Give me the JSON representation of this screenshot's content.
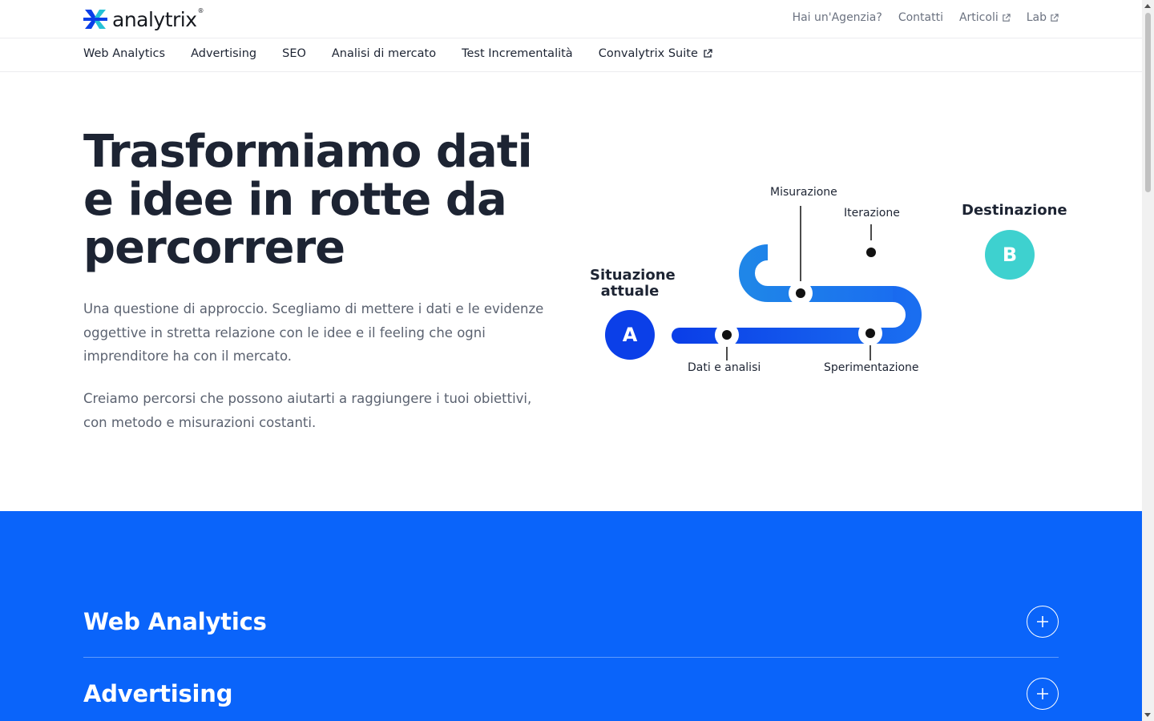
{
  "brand": {
    "name": "analytrix",
    "mark": "®"
  },
  "top_links": [
    {
      "label": "Hai un'Agenzia?",
      "external": false
    },
    {
      "label": "Contatti",
      "external": false
    },
    {
      "label": "Articoli",
      "external": true
    },
    {
      "label": "Lab",
      "external": true
    }
  ],
  "main_nav": [
    {
      "label": "Web Analytics"
    },
    {
      "label": "Advertising"
    },
    {
      "label": "SEO"
    },
    {
      "label": "Analisi di mercato"
    },
    {
      "label": "Test Incrementalità"
    },
    {
      "label": "Convalytrix Suite"
    }
  ],
  "hero": {
    "title": "Trasformiamo dati e idee in rotte da percorrere",
    "paragraph_1": "Una questione di approccio. Scegliamo di mettere i dati e le evidenze oggettive in stretta relazione con le idee e il feeling che ogni imprenditore ha con il mercato.",
    "paragraph_2": "Creiamo percorsi che possono aiutarti a raggiungere i tuoi obiettivi, con metodo e misurazioni costanti."
  },
  "diagram": {
    "start_label_line1": "Situazione",
    "start_label_line2": "attuale",
    "start_letter": "A",
    "end_label": "Destinazione",
    "end_letter": "B",
    "steps": {
      "data": "Dati e  analisi",
      "experiment": "Sperimentazione",
      "measure": "Misurazione",
      "iterate": "Iterazione"
    }
  },
  "sections": [
    {
      "title": "Web Analytics"
    },
    {
      "title": "Advertising"
    }
  ],
  "colors": {
    "accent_blue": "#0a64fa",
    "start_blue": "#0b3fe8",
    "end_teal": "#3ed1cf",
    "text_dark": "#1d2433",
    "text_muted": "#5b6270"
  },
  "icons": {
    "external_link": "external-link-icon",
    "expand": "plus-icon"
  }
}
